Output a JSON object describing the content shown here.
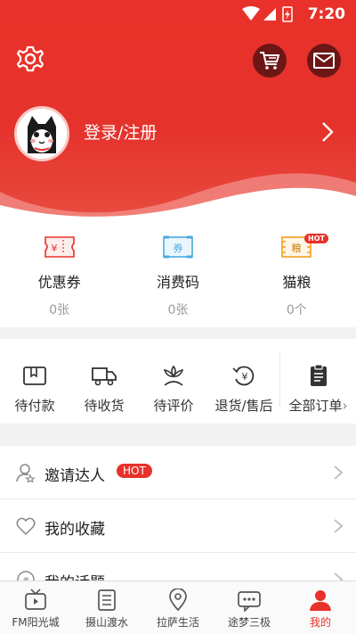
{
  "status": {
    "time": "7:20"
  },
  "user": {
    "login_label": "登录/注册"
  },
  "wallet": [
    {
      "label": "优惠券",
      "value": "0张",
      "icon": "coupon-icon",
      "icon_text": "¥"
    },
    {
      "label": "消费码",
      "value": "0张",
      "icon": "voucher-icon",
      "icon_text": "券"
    },
    {
      "label": "猫粮",
      "value": "0个",
      "icon": "grain-icon",
      "icon_text": "粮"
    }
  ],
  "wallet_hot": "HOT",
  "orders": [
    {
      "label": "待付款",
      "icon": "wallet-icon"
    },
    {
      "label": "待收货",
      "icon": "truck-icon"
    },
    {
      "label": "待评价",
      "icon": "flower-icon"
    },
    {
      "label": "退货/售后",
      "icon": "refund-icon"
    },
    {
      "label": "全部订单",
      "icon": "clipboard-icon"
    }
  ],
  "list": [
    {
      "label": "邀请达人",
      "badge": "HOT",
      "icon": "invite-user-icon"
    },
    {
      "label": "我的收藏",
      "icon": "heart-icon"
    },
    {
      "label": "我的话题",
      "icon": "topic-icon"
    }
  ],
  "tabs": [
    {
      "label": "FM阳光城",
      "icon": "tv-icon",
      "active": false
    },
    {
      "label": "摄山渡水",
      "icon": "list-icon",
      "active": false
    },
    {
      "label": "拉萨生活",
      "icon": "location-icon",
      "active": false
    },
    {
      "label": "途梦三极",
      "icon": "chat-icon",
      "active": false
    },
    {
      "label": "我的",
      "icon": "person-icon",
      "active": true
    }
  ],
  "colors": {
    "brand_red": "#e8312a",
    "dark_btn": "#6d1616"
  }
}
